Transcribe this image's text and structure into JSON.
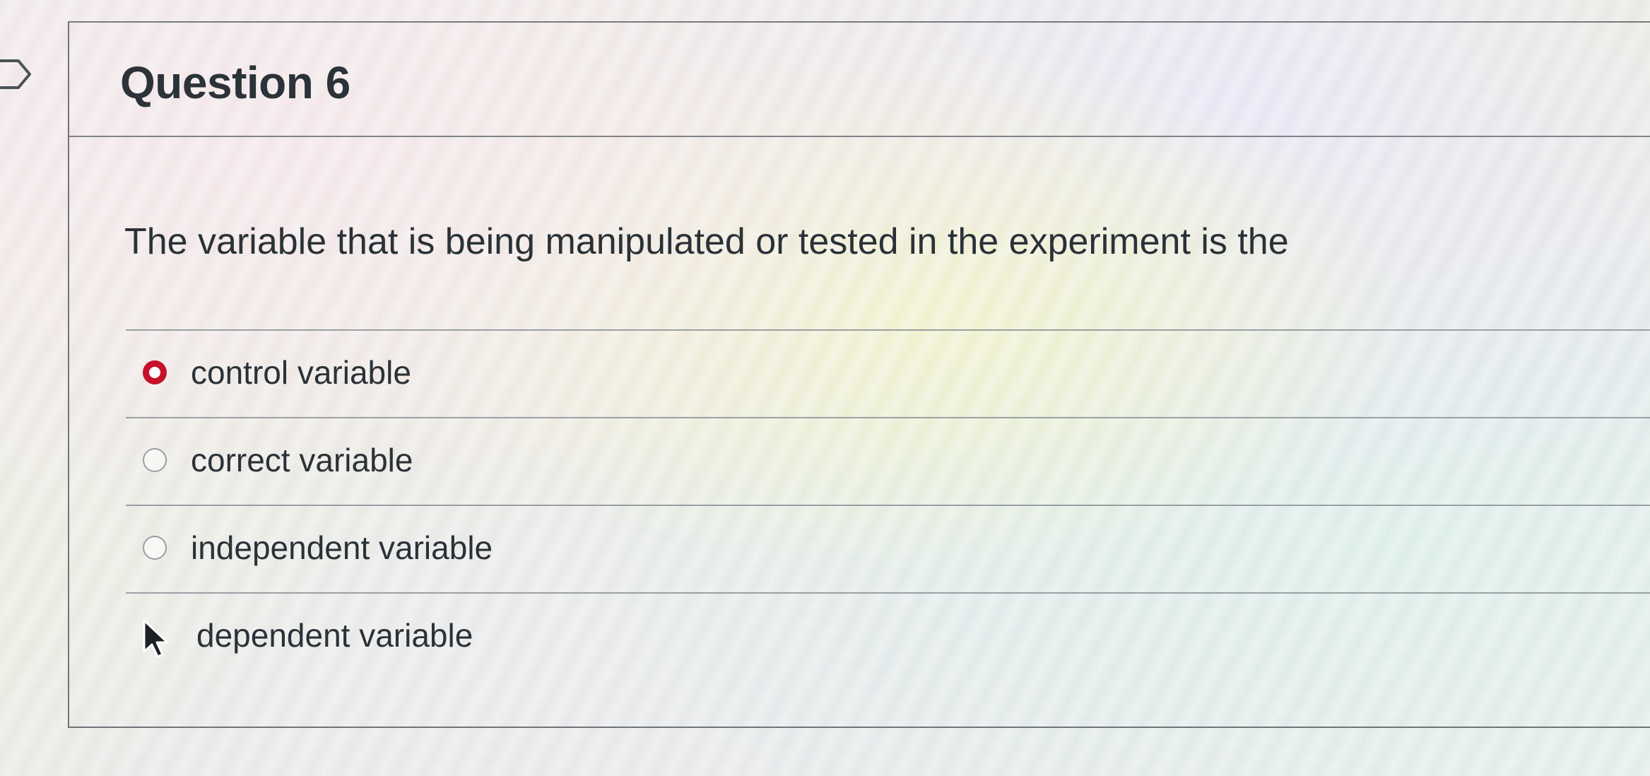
{
  "question": {
    "title": "Question 6",
    "prompt": "The variable that is being manipulated or tested in the experiment is the",
    "options": [
      {
        "label": "control variable",
        "selected": true
      },
      {
        "label": "correct variable",
        "selected": false
      },
      {
        "label": "independent variable",
        "selected": false
      },
      {
        "label": "dependent variable",
        "selected": false
      }
    ]
  },
  "colors": {
    "selected_radio": "#c6112b",
    "text": "#2a3238",
    "divider": "#9aa0a4"
  },
  "icons": {
    "tab_marker": "question-flag-icon",
    "pointer": "mouse-pointer-icon"
  }
}
